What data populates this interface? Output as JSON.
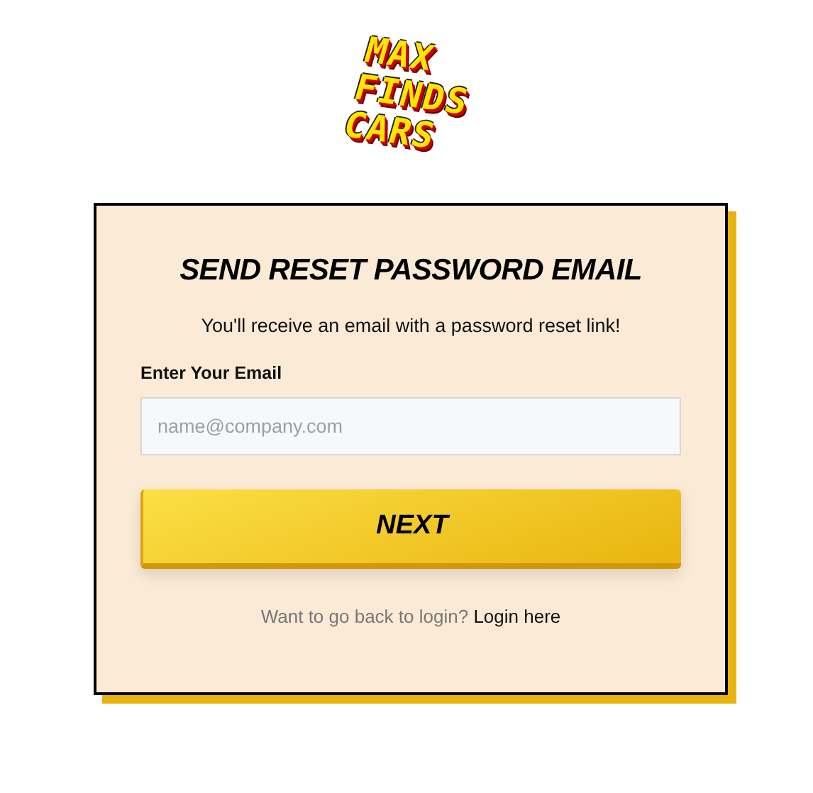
{
  "logo": {
    "lines": [
      "MAX",
      "FINDS",
      "CARS"
    ]
  },
  "card": {
    "title": "SEND RESET PASSWORD EMAIL",
    "subtitle": "You'll receive an email with a password reset link!",
    "email_field": {
      "label": "Enter Your Email",
      "placeholder": "name@company.com"
    },
    "next_button": {
      "label": "NEXT"
    },
    "footer": {
      "text": "Want to go back to login?",
      "link": "Login here"
    }
  }
}
